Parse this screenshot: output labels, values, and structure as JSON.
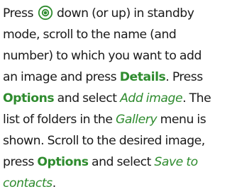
{
  "instruction": {
    "l1_before_key": "Press ",
    "navigation_key_icon": "scroll-key-icon",
    "l1_after_key": " down (or up) in standby",
    "l2": "mode, scroll to the name (and",
    "l3": "number) to which you want to add",
    "l4_text": "an image and press ",
    "l4_details": "Details",
    "l4_end": ". Press",
    "l5_options": "Options",
    "l5_text": " and select ",
    "l5_add_image": "Add image",
    "l5_end": ". The",
    "l6_text": "list of folders in the ",
    "l6_gallery": "Gallery",
    "l6_end": " menu is",
    "l7": "shown. Scroll to the desired image,",
    "l8_text": "press ",
    "l8_options": "Options",
    "l8_text2": " and select ",
    "l8_save_to": "Save to",
    "l9_contacts": "contacts",
    "l9_end": "."
  },
  "colors": {
    "highlight": "#2e8b2e",
    "text": "#1a1a1a"
  }
}
